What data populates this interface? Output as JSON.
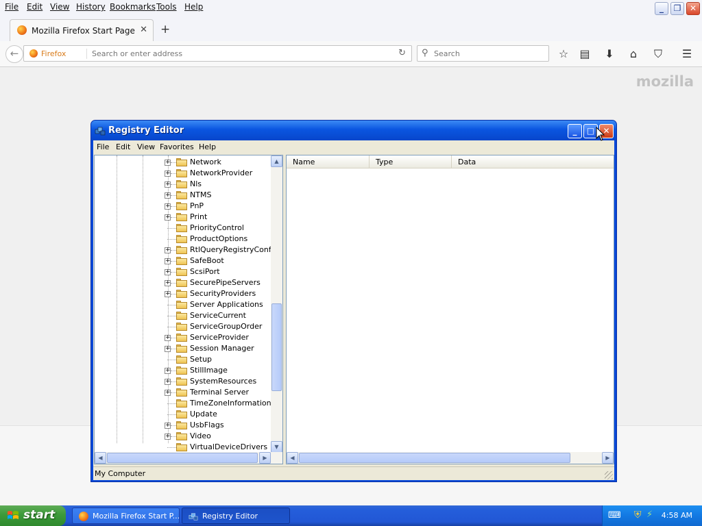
{
  "firefox": {
    "menu": [
      "File",
      "Edit",
      "View",
      "History",
      "Bookmarks",
      "Tools",
      "Help"
    ],
    "tab_title": "Mozilla Firefox Start Page",
    "identity_label": "Firefox",
    "url_placeholder": "Search or enter address",
    "search_placeholder": "Search",
    "brand": "mozilla"
  },
  "regedit": {
    "title": "Registry Editor",
    "menu": [
      "File",
      "Edit",
      "View",
      "Favorites",
      "Help"
    ],
    "tree_items": [
      {
        "label": "Network",
        "expandable": true
      },
      {
        "label": "NetworkProvider",
        "expandable": true
      },
      {
        "label": "Nls",
        "expandable": true
      },
      {
        "label": "NTMS",
        "expandable": true
      },
      {
        "label": "PnP",
        "expandable": true
      },
      {
        "label": "Print",
        "expandable": true
      },
      {
        "label": "PriorityControl",
        "expandable": false
      },
      {
        "label": "ProductOptions",
        "expandable": false
      },
      {
        "label": "RtlQueryRegistryConfig",
        "expandable": true
      },
      {
        "label": "SafeBoot",
        "expandable": true
      },
      {
        "label": "ScsiPort",
        "expandable": true
      },
      {
        "label": "SecurePipeServers",
        "expandable": true
      },
      {
        "label": "SecurityProviders",
        "expandable": true
      },
      {
        "label": "Server Applications",
        "expandable": false
      },
      {
        "label": "ServiceCurrent",
        "expandable": false
      },
      {
        "label": "ServiceGroupOrder",
        "expandable": false
      },
      {
        "label": "ServiceProvider",
        "expandable": true
      },
      {
        "label": "Session Manager",
        "expandable": true
      },
      {
        "label": "Setup",
        "expandable": false
      },
      {
        "label": "StillImage",
        "expandable": true
      },
      {
        "label": "SystemResources",
        "expandable": true
      },
      {
        "label": "Terminal Server",
        "expandable": true
      },
      {
        "label": "TimeZoneInformation",
        "expandable": false
      },
      {
        "label": "Update",
        "expandable": false
      },
      {
        "label": "UsbFlags",
        "expandable": true
      },
      {
        "label": "Video",
        "expandable": true
      },
      {
        "label": "VirtualDeviceDrivers",
        "expandable": false
      }
    ],
    "columns": [
      "Name",
      "Type",
      "Data"
    ],
    "status": "My Computer"
  },
  "taskbar": {
    "start_label": "start",
    "tasks": [
      {
        "label": "Mozilla Firefox Start P..."
      },
      {
        "label": "Registry Editor"
      }
    ],
    "clock": "4:58 AM"
  },
  "colors": {
    "xp_title_blue": "#0a55e0",
    "taskbar_blue": "#245edb",
    "start_green": "#3c9a3a",
    "firefox_orange": "#f07c19"
  }
}
